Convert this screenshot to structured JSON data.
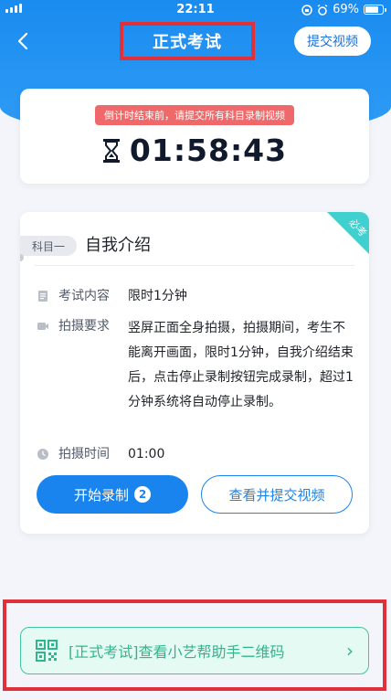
{
  "status_bar": {
    "time": "22:11",
    "battery": "69%"
  },
  "nav": {
    "title": "正式考试",
    "submit_label": "提交视频"
  },
  "countdown": {
    "tip": "倒计时结束前，请提交所有科目录制视频",
    "time": "01:58:43"
  },
  "subject": {
    "ribbon": "必考",
    "tag": "科目一",
    "title": "自我介绍",
    "rows": [
      {
        "label": "考试内容",
        "value": "限时1分钟",
        "icon": "document-icon"
      },
      {
        "label": "拍摄要求",
        "value": "竖屏正面全身拍摄，拍摄期间，考生不能离开画面，限时1分钟，自我介绍结束后，点击停止录制按钮完成录制，超过1分钟系统将自动停止录制。",
        "icon": "video-camera-icon"
      },
      {
        "label": "拍摄时间",
        "value": "01:00",
        "icon": "clock-icon"
      }
    ],
    "start_label": "开始录制",
    "start_badge": "2",
    "view_label": "查看并提交视频"
  },
  "qr_bar": {
    "label": "[正式考试]查看小艺帮助手二维码",
    "icon": "qr-code-icon",
    "arrow": "›"
  },
  "colors": {
    "primary": "#1a84ee",
    "highlight": "#e0313a",
    "accent_green": "#2fb68a",
    "ribbon": "#3fd0cf",
    "tip_bg": "#f0696a"
  }
}
